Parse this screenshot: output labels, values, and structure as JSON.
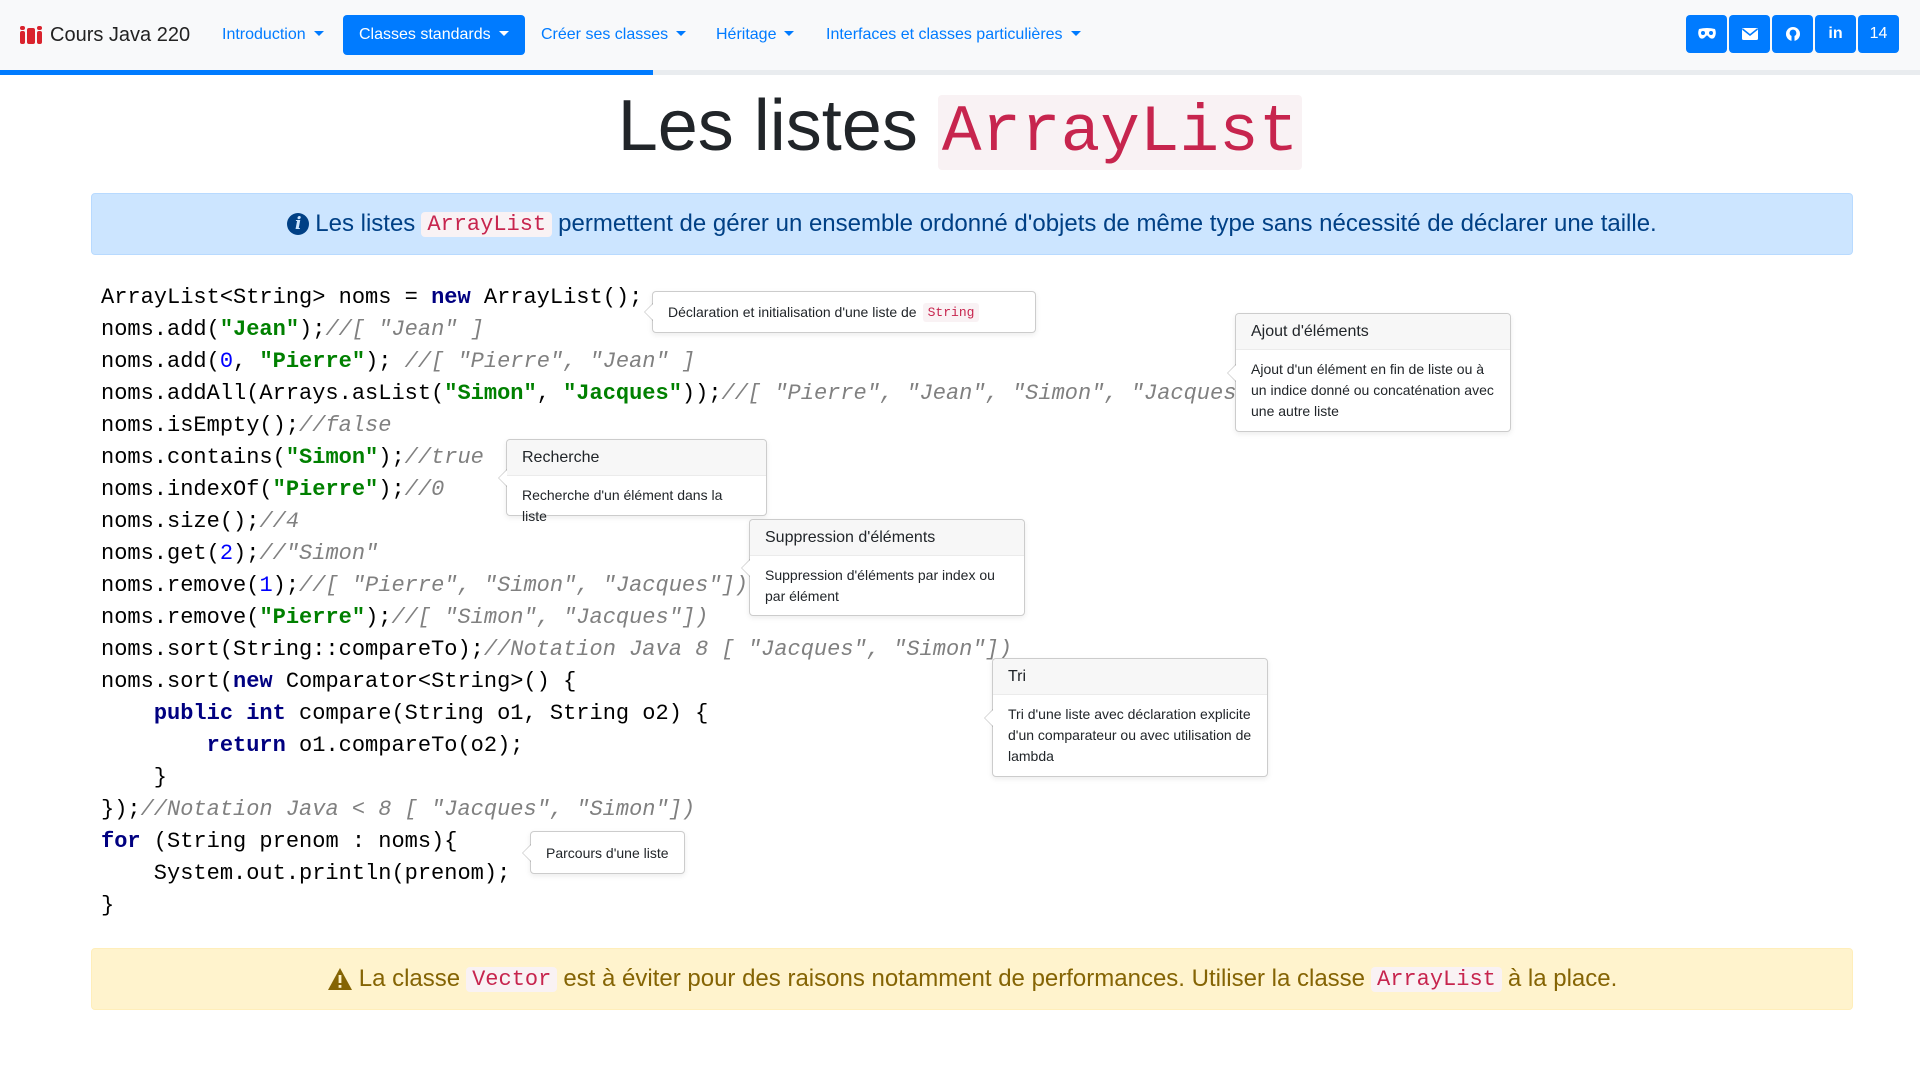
{
  "navbar": {
    "brand": "Cours Java 220",
    "items": [
      {
        "label": "Introduction"
      },
      {
        "label": "Classes standards"
      },
      {
        "label": "Créer ses classes"
      },
      {
        "label": "Héritage"
      },
      {
        "label": "Interfaces et classes particulières"
      }
    ],
    "social": [
      {
        "icon": "mask-icon"
      },
      {
        "icon": "envelope-icon"
      },
      {
        "icon": "github-icon"
      },
      {
        "icon": "linkedin-icon",
        "text": "in"
      },
      {
        "text": "14"
      }
    ],
    "progress": 0.34,
    "accent": "#007bff"
  },
  "title": {
    "text": "Les listes",
    "code": "ArrayList"
  },
  "info_alert": {
    "before": "Les listes",
    "code": "ArrayList",
    "after": "permettent de gérer un ensemble ordonné d'objets de même type sans nécessité de déclarer une taille."
  },
  "code": {
    "lines": [
      [
        {
          "t": "ArrayList<String> noms = "
        },
        {
          "t": "new",
          "c": "kw"
        },
        {
          "t": " ArrayList();"
        }
      ],
      [
        {
          "t": "noms.add("
        },
        {
          "t": "\"Jean\"",
          "c": "str"
        },
        {
          "t": ");"
        },
        {
          "t": "//[ \"Jean\" ]",
          "c": "cmt"
        }
      ],
      [
        {
          "t": "noms.add("
        },
        {
          "t": "0",
          "c": "num"
        },
        {
          "t": ", "
        },
        {
          "t": "\"Pierre\"",
          "c": "str"
        },
        {
          "t": "); "
        },
        {
          "t": "//[ \"Pierre\", \"Jean\" ]",
          "c": "cmt"
        }
      ],
      [
        {
          "t": "noms.addAll(Arrays.asList("
        },
        {
          "t": "\"Simon\"",
          "c": "str"
        },
        {
          "t": ", "
        },
        {
          "t": "\"Jacques\"",
          "c": "str"
        },
        {
          "t": "));"
        },
        {
          "t": "//[ \"Pierre\", \"Jean\", \"Simon\", \"Jacques\"]",
          "c": "cmt"
        }
      ],
      [
        {
          "t": "noms.isEmpty();"
        },
        {
          "t": "//false",
          "c": "cmt"
        }
      ],
      [
        {
          "t": "noms.contains("
        },
        {
          "t": "\"Simon\"",
          "c": "str"
        },
        {
          "t": ");"
        },
        {
          "t": "//true",
          "c": "cmt"
        }
      ],
      [
        {
          "t": "noms.indexOf("
        },
        {
          "t": "\"Pierre\"",
          "c": "str"
        },
        {
          "t": ");"
        },
        {
          "t": "//0",
          "c": "cmt"
        }
      ],
      [
        {
          "t": "noms.size();"
        },
        {
          "t": "//4",
          "c": "cmt"
        }
      ],
      [
        {
          "t": "noms.get("
        },
        {
          "t": "2",
          "c": "num"
        },
        {
          "t": ");"
        },
        {
          "t": "//\"Simon\"",
          "c": "cmt"
        }
      ],
      [
        {
          "t": "noms.remove("
        },
        {
          "t": "1",
          "c": "num"
        },
        {
          "t": ");"
        },
        {
          "t": "//[ \"Pierre\", \"Simon\", \"Jacques\"])",
          "c": "cmt"
        }
      ],
      [
        {
          "t": "noms.remove("
        },
        {
          "t": "\"Pierre\"",
          "c": "str"
        },
        {
          "t": ");"
        },
        {
          "t": "//[ \"Simon\", \"Jacques\"])",
          "c": "cmt"
        }
      ],
      [
        {
          "t": "noms.sort(String::compareTo);"
        },
        {
          "t": "//Notation Java 8 [ \"Jacques\", \"Simon\"])",
          "c": "cmt"
        }
      ],
      [
        {
          "t": "noms.sort("
        },
        {
          "t": "new",
          "c": "kw"
        },
        {
          "t": " Comparator<String>() {"
        }
      ],
      [
        {
          "t": "    "
        },
        {
          "t": "public",
          "c": "kw"
        },
        {
          "t": " "
        },
        {
          "t": "int",
          "c": "kw"
        },
        {
          "t": " compare(String o1, String o2) {"
        }
      ],
      [
        {
          "t": "        "
        },
        {
          "t": "return",
          "c": "kw"
        },
        {
          "t": " o1.compareTo(o2);"
        }
      ],
      [
        {
          "t": "    }"
        }
      ],
      [
        {
          "t": "});"
        },
        {
          "t": "//Notation Java < 8 [ \"Jacques\", \"Simon\"])",
          "c": "cmt"
        }
      ],
      [
        {
          "t": "for",
          "c": "kw"
        },
        {
          "t": " (String prenom : noms){"
        }
      ],
      [
        {
          "t": "    System.out.println(prenom);"
        }
      ],
      [
        {
          "t": "}"
        }
      ]
    ]
  },
  "popovers": {
    "declaration": {
      "text": "Déclaration et initialisation d'une liste de",
      "code": "String"
    },
    "ajout": {
      "title": "Ajout d'éléments",
      "body": "Ajout d'un élément en fin de liste ou à un indice donné ou concaténation avec une autre liste"
    },
    "recherche": {
      "title": "Recherche",
      "body": "Recherche d'un élément dans la liste"
    },
    "suppression": {
      "title": "Suppression d'éléments",
      "body": "Suppression d'éléments par index ou par élément"
    },
    "tri": {
      "title": "Tri",
      "body": "Tri d'une liste avec déclaration explicite d'un comparateur ou avec utilisation de lambda"
    },
    "parcours": {
      "text": "Parcours d'une liste"
    }
  },
  "warning_alert": {
    "before": "La classe",
    "code1": "Vector",
    "middle": "est à éviter pour des raisons notamment de performances. Utiliser la classe",
    "code2": "ArrayList",
    "after": "à la place."
  }
}
